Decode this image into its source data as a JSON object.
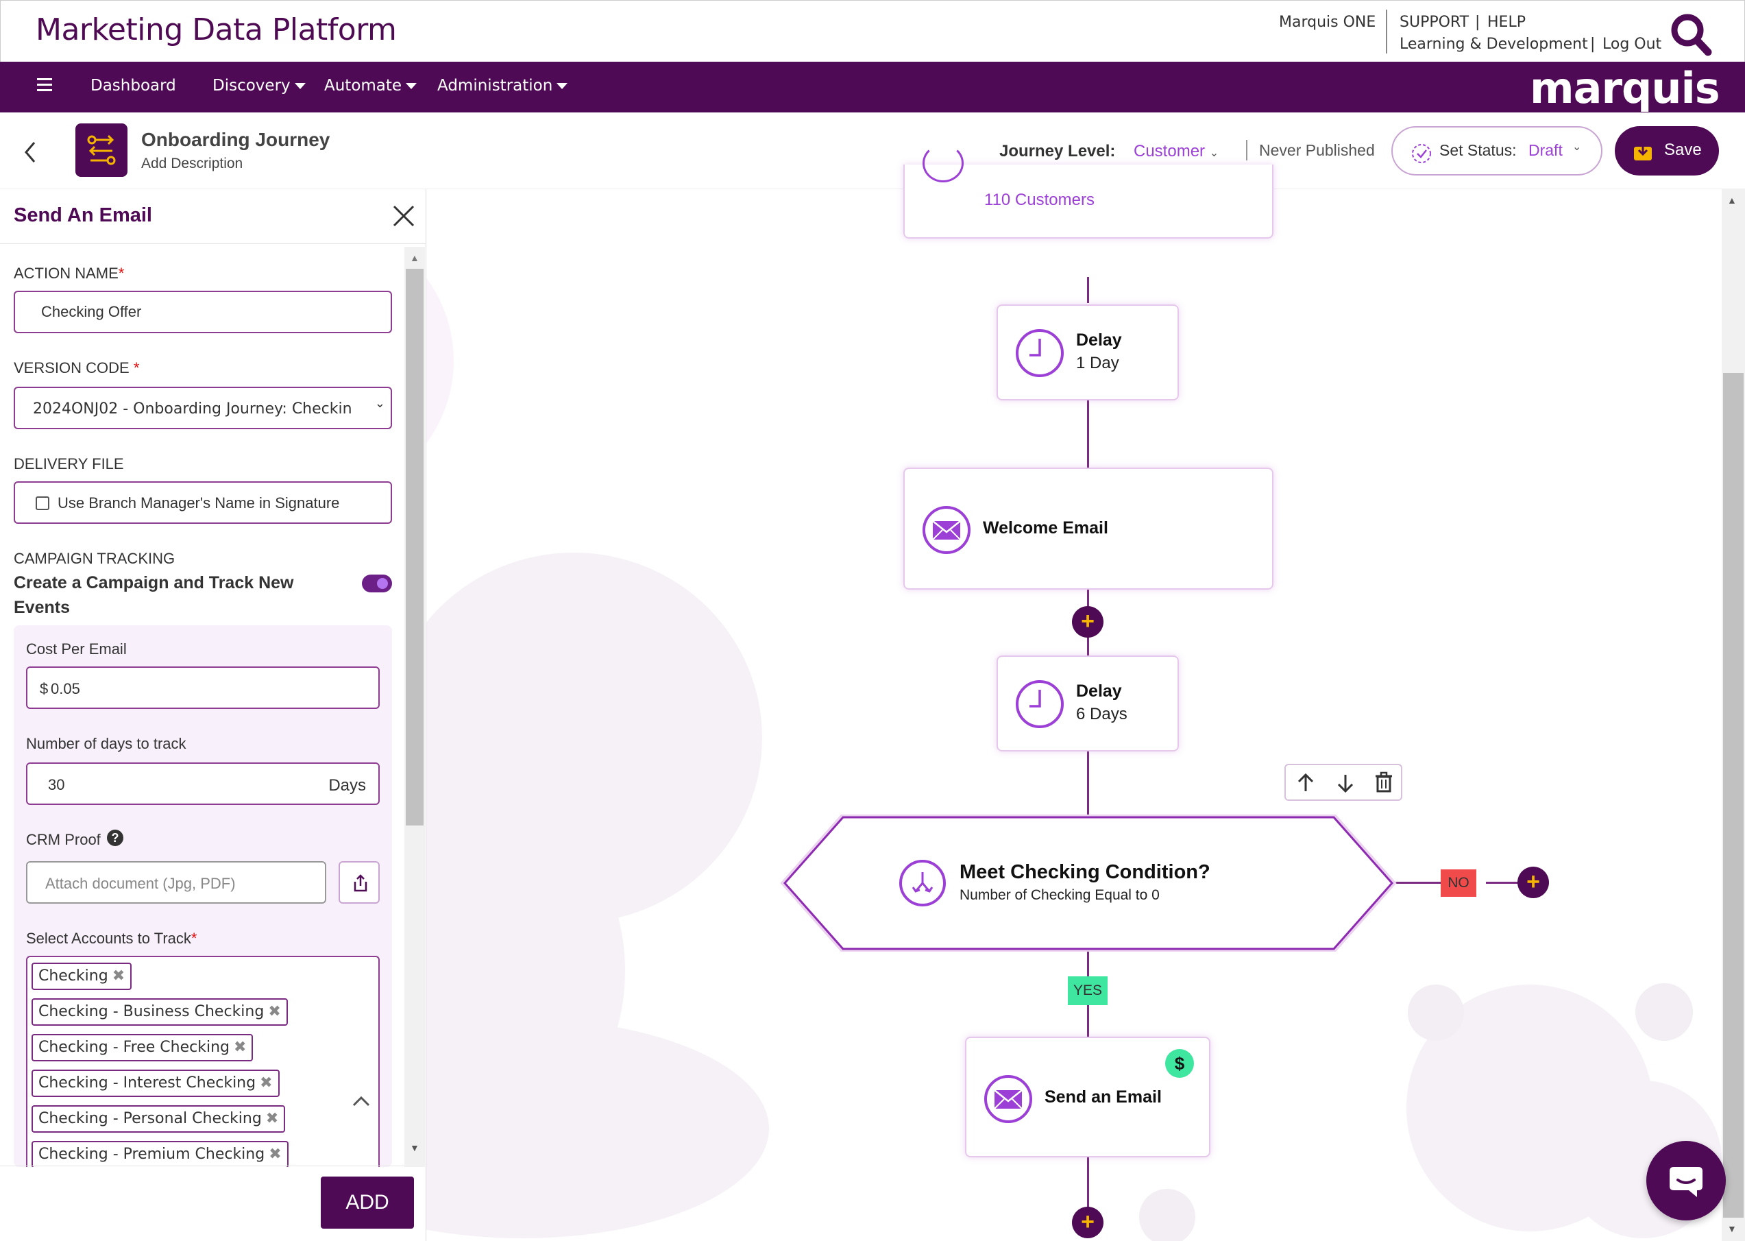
{
  "app": {
    "title": "Marketing Data Platform",
    "logo_text": "marquis"
  },
  "top_links": {
    "marquis_one": "Marquis ONE",
    "support": "SUPPORT",
    "sep1": "|",
    "help": "HELP",
    "learning": "Learning & Development",
    "sep2": "|",
    "logout": "Log Out"
  },
  "nav": {
    "menu_icon": "hamburger-icon",
    "dashboard": "Dashboard",
    "discovery": "Discovery",
    "automate": "Automate",
    "administration": "Administration"
  },
  "journey": {
    "title": "Onboarding Journey",
    "description": "Add Description",
    "level_label": "Journey Level:",
    "level_value": "Customer",
    "publish_state": "Never Published",
    "status_label": "Set Status:",
    "status_value": "Draft",
    "save_label": "Save"
  },
  "panel": {
    "title": "Send An Email",
    "action_name_label": "ACTION NAME",
    "action_name_value": "Checking Offer",
    "version_code_label": "VERSION CODE ",
    "version_code_value": "2024ONJ02 - Onboarding Journey: Checkin",
    "delivery_file_label": "DELIVERY FILE",
    "delivery_checkbox_label": "Use Branch Manager's Name in Signature",
    "campaign_tracking_label": "CAMPAIGN TRACKING",
    "campaign_toggle_label": "Create a Campaign and Track New Events",
    "campaign_toggle_on": true,
    "cost_label": "Cost Per Email",
    "cost_currency": "$",
    "cost_value": "0.05",
    "days_label": "Number of days to track",
    "days_value": "30",
    "days_unit": "Days",
    "crm_label": "CRM Proof",
    "crm_placeholder": "Attach document (Jpg, PDF)",
    "accounts_label": "Select Accounts to Track",
    "accounts": [
      "Checking",
      "Checking - Business Checking",
      "Checking - Free Checking",
      "Checking - Interest Checking",
      "Checking - Personal Checking",
      "Checking - Premium Checking"
    ],
    "add_button": "ADD"
  },
  "flow": {
    "top_node_count": "110 Customers",
    "delay1_title": "Delay",
    "delay1_value": "1 Day",
    "welcome_title": "Welcome Email",
    "delay2_title": "Delay",
    "delay2_value": "6 Days",
    "condition_title": "Meet Checking Condition?",
    "condition_sub": "Number of Checking Equal to 0",
    "no_label": "NO",
    "yes_label": "YES",
    "send_title": "Send an Email",
    "cost_badge": "$"
  },
  "colors": {
    "brand": "#4f0a55",
    "accent": "#9b3fd6",
    "plus": "#f5b400",
    "no": "#f04a4a",
    "yes": "#3fe6a0"
  }
}
